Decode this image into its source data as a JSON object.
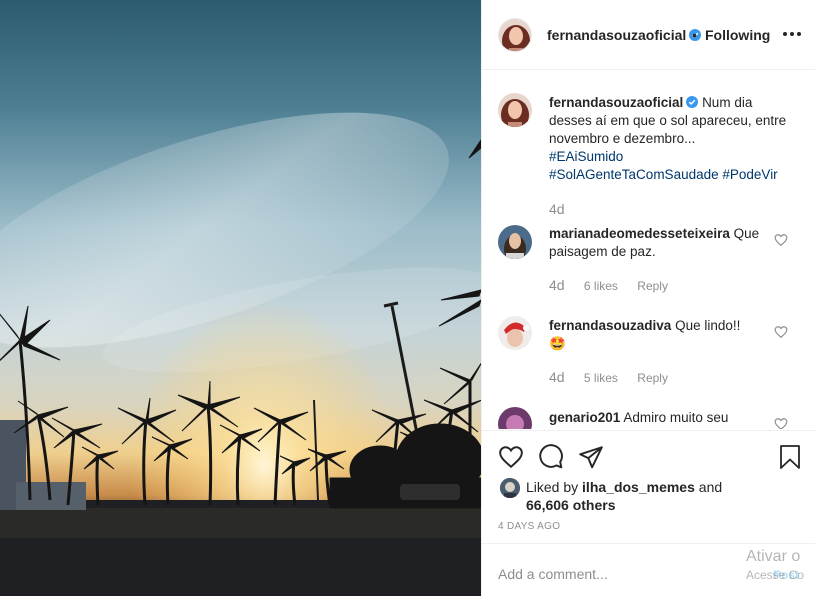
{
  "post": {
    "username": "fernandasouzaoficial",
    "dot": "•",
    "follow_status": "Following"
  },
  "caption": {
    "username": "fernandasouzaoficial",
    "text": "Num dia desses aí em que o sol apareceu, entre novembro e dezembro...",
    "hashtags": [
      "#EAiSumido",
      "#SolAGenteTaComSaudade",
      "#PodeVir"
    ],
    "age": "4d"
  },
  "comments": [
    {
      "username": "marianadeomedesseteixeira",
      "text": "Que paisagem de paz.",
      "age": "4d",
      "likes": "6 likes",
      "reply": "Reply"
    },
    {
      "username": "fernandasouzadiva",
      "text": "Que lindo!!",
      "emoji": "🤩",
      "age": "4d",
      "likes": "5 likes",
      "reply": "Reply"
    },
    {
      "username": "genario201",
      "text": "Admiro muito seu"
    }
  ],
  "likes": {
    "liked_by": "Liked by",
    "liker": "ilha_dos_memes",
    "and": "and",
    "count": "66,606 others"
  },
  "timestamp": "4 DAYS AGO",
  "add_comment": {
    "placeholder": "Add a comment...",
    "post_label": "Post"
  },
  "watermark": {
    "line1": "Ativar o",
    "line2": "Acesse Co"
  },
  "icons": {
    "like": "heart-icon",
    "comment": "comment-icon",
    "share": "paper-plane-icon",
    "save": "bookmark-icon",
    "more": "more-options-icon",
    "verified": "verified-badge-icon"
  },
  "colors": {
    "link_blue": "#00376b",
    "verified_blue": "#3897f0",
    "muted": "#8e8e8e",
    "post_button": "#b2dffc"
  }
}
